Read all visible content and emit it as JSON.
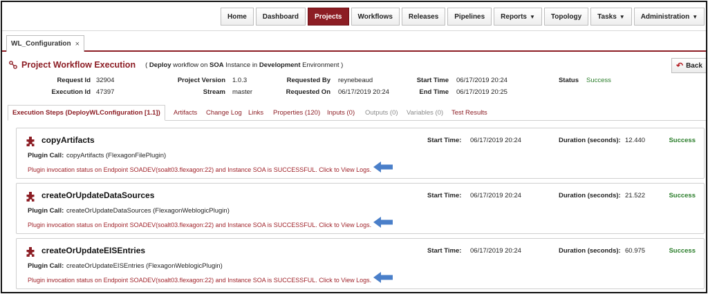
{
  "nav": {
    "items": [
      {
        "label": "Home",
        "caret": false,
        "active": false
      },
      {
        "label": "Dashboard",
        "caret": false,
        "active": false
      },
      {
        "label": "Projects",
        "caret": false,
        "active": true
      },
      {
        "label": "Workflows",
        "caret": false,
        "active": false
      },
      {
        "label": "Releases",
        "caret": false,
        "active": false
      },
      {
        "label": "Pipelines",
        "caret": false,
        "active": false
      },
      {
        "label": "Reports",
        "caret": true,
        "active": false
      },
      {
        "label": "Topology",
        "caret": false,
        "active": false
      },
      {
        "label": "Tasks",
        "caret": true,
        "active": false
      },
      {
        "label": "Administration",
        "caret": true,
        "active": false
      }
    ],
    "caret_glyph": "▼"
  },
  "file_tab": {
    "label": "WL_Configuration",
    "close_glyph": "×"
  },
  "page": {
    "title": "Project Workflow Execution",
    "subtitle": {
      "open": "(",
      "action": "Deploy",
      "t1": "workflow on",
      "instance": "SOA",
      "t2": "Instance in",
      "environment": "Development",
      "t3": "Environment )"
    },
    "back_label": "Back"
  },
  "meta": {
    "request_id_label": "Request Id",
    "request_id": "32904",
    "execution_id_label": "Execution Id",
    "execution_id": "47397",
    "project_version_label": "Project Version",
    "project_version": "1.0.3",
    "stream_label": "Stream",
    "stream": "master",
    "requested_by_label": "Requested By",
    "requested_by": "reynebeaud",
    "requested_on_label": "Requested On",
    "requested_on": "06/17/2019 20:24",
    "start_time_label": "Start Time",
    "start_time": "06/17/2019 20:24",
    "end_time_label": "End Time",
    "end_time": "06/17/2019 20:25",
    "status_label": "Status",
    "status": "Success"
  },
  "exec_tabs": [
    {
      "label": "Execution Steps (DeployWLConfiguration [1.1])",
      "active": true,
      "disabled": false
    },
    {
      "label": "Artifacts",
      "active": false,
      "disabled": false
    },
    {
      "label": "Change Log",
      "active": false,
      "disabled": false
    },
    {
      "label": "Links",
      "active": false,
      "disabled": false
    },
    {
      "label": "Properties (120)",
      "active": false,
      "disabled": false
    },
    {
      "label": "Inputs (0)",
      "active": false,
      "disabled": false
    },
    {
      "label": "Outputs (0)",
      "active": false,
      "disabled": true
    },
    {
      "label": "Variables (0)",
      "active": false,
      "disabled": true
    },
    {
      "label": "Test Results",
      "active": false,
      "disabled": false
    }
  ],
  "steps": [
    {
      "name": "copyArtifacts",
      "plugin_label": "Plugin Call:",
      "plugin_call": "copyArtifacts (FlexagonFilePlugin)",
      "status_message": "Plugin invocation status on Endpoint SOADEV(soalt03.flexagon:22) and Instance SOA is SUCCESSFUL. Click to View Logs.",
      "start_label": "Start Time:",
      "start_time": "06/17/2019 20:24",
      "duration_label": "Duration (seconds):",
      "duration": "12.440",
      "result": "Success"
    },
    {
      "name": "createOrUpdateDataSources",
      "plugin_label": "Plugin Call:",
      "plugin_call": "createOrUpdateDataSources (FlexagonWeblogicPlugin)",
      "status_message": "Plugin invocation status on Endpoint SOADEV(soalt03.flexagon:22) and Instance SOA is SUCCESSFUL. Click to View Logs.",
      "start_label": "Start Time:",
      "start_time": "06/17/2019 20:24",
      "duration_label": "Duration (seconds):",
      "duration": "21.522",
      "result": "Success"
    },
    {
      "name": "createOrUpdateEISEntries",
      "plugin_label": "Plugin Call:",
      "plugin_call": "createOrUpdateEISEntries (FlexagonWeblogicPlugin)",
      "status_message": "Plugin invocation status on Endpoint SOADEV(soalt03.flexagon:22) and Instance SOA is SUCCESSFUL. Click to View Logs.",
      "start_label": "Start Time:",
      "start_time": "06/17/2019 20:24",
      "duration_label": "Duration (seconds):",
      "duration": "60.975",
      "result": "Success"
    }
  ],
  "colors": {
    "brand": "#8c1d24",
    "success": "#2a7d2a",
    "annotation_arrow": "#4a7fc9"
  },
  "icons": {
    "back": "back-arrow-icon",
    "step": "puzzle-icon",
    "title": "workflow-icon",
    "annotation": "blue-arrow-icon"
  }
}
